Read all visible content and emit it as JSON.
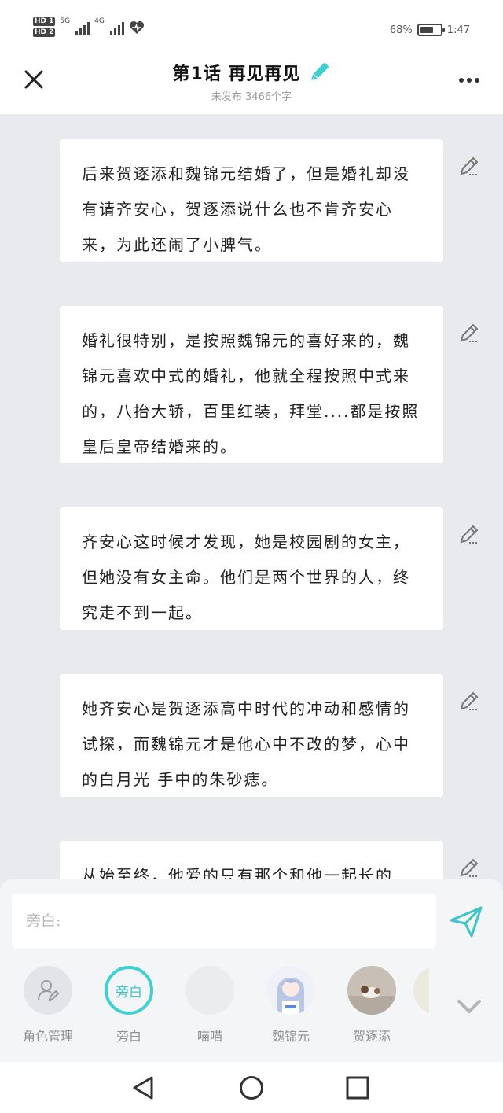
{
  "status": {
    "sim1": "HD 1",
    "sim2": "HD 2",
    "net1": "5G",
    "net2": "4G",
    "battery_percent": "68%",
    "battery_level": 0.68,
    "time": "1:47"
  },
  "header": {
    "title": "第1话 再见再见",
    "subtitle": "未发布 3466个字"
  },
  "cards": [
    {
      "text": "后来贺逐添和魏锦元结婚了，但是婚礼却没有请齐安心，贺逐添说什么也不肯齐安心来，为此还闹了小脾气。"
    },
    {
      "text": "婚礼很特别，是按照魏锦元的喜好来的，魏锦元喜欢中式的婚礼，他就全程按照中式来的，八抬大轿，百里红装，拜堂....都是按照皇后皇帝结婚来的。"
    },
    {
      "text": "齐安心这时候才发现，她是校园剧的女主，但她没有女主命。他们是两个世界的人，终究走不到一起。"
    },
    {
      "text": "她齐安心是贺逐添高中时代的冲动和感情的试探，而魏锦元才是他心中不改的梦，心中的白月光 手中的朱砂痣。"
    },
    {
      "text": "从始至终，他爱的只有那个和他一起长的"
    }
  ],
  "composer": {
    "placeholder": "旁白:"
  },
  "roles": [
    {
      "name": "角色管理",
      "avatar_label": ""
    },
    {
      "name": "旁白",
      "avatar_label": "旁白"
    },
    {
      "name": "喵喵",
      "avatar_label": ""
    },
    {
      "name": "魏锦元",
      "avatar_label": ""
    },
    {
      "name": "贺逐添",
      "avatar_label": ""
    }
  ],
  "colors": {
    "accent": "#3fd0d4",
    "background": "#e9eaee",
    "card": "#ffffff"
  }
}
